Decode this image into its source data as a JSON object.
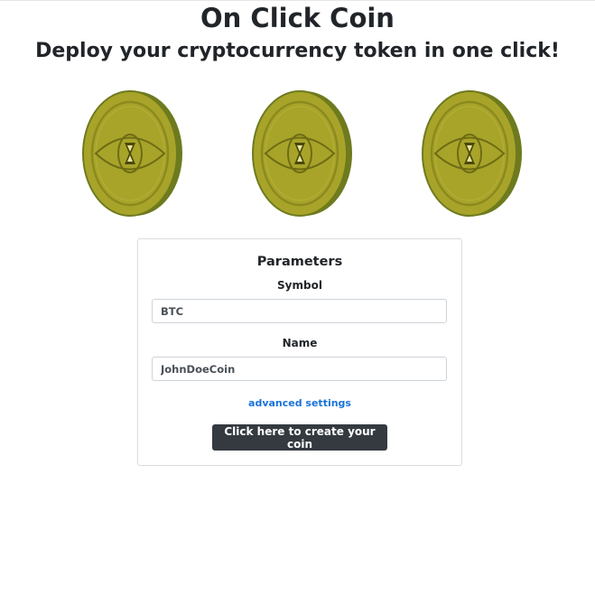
{
  "header": {
    "title": "On Click Coin",
    "subtitle": "Deploy your cryptocurrency token in one click!"
  },
  "coins": [
    {
      "icon": "coin-eye-icon"
    },
    {
      "icon": "coin-eye-icon"
    },
    {
      "icon": "coin-eye-icon"
    }
  ],
  "colors": {
    "coin_face": "#a8a42a",
    "coin_edge": "#6e7a1e",
    "button_bg": "#343a40",
    "link": "#1a73d9"
  },
  "form": {
    "title": "Parameters",
    "symbol_label": "Symbol",
    "symbol_value": "BTC",
    "name_label": "Name",
    "name_value": "JohnDoeCoin",
    "advanced_link": "advanced settings",
    "submit_label": "Click here to create your coin"
  }
}
